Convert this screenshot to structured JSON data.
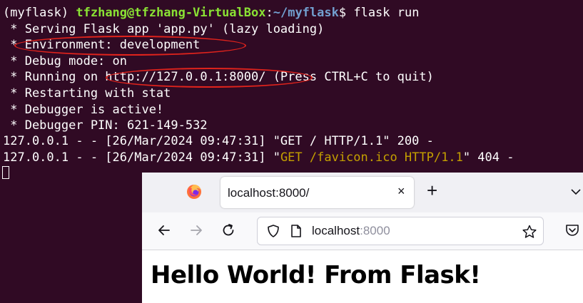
{
  "terminal": {
    "prompt": {
      "env": "(myflask)",
      "userhost": "tfzhang@tfzhang-VirtualBox",
      "colon": ":",
      "path": "~/myflask",
      "dollar": "$",
      "command": " flask run"
    },
    "output": [
      " * Serving Flask app 'app.py' (lazy loading)",
      " * Environment: development",
      " * Debug mode: on",
      " * Running on http://127.0.0.1:8000/ (Press CTRL+C to quit)",
      " * Restarting with stat",
      " * Debugger is active!",
      " * Debugger PIN: 621-149-532",
      "127.0.0.1 - - [26/Mar/2024 09:47:31] \"GET / HTTP/1.1\" 200 -"
    ],
    "last_log": {
      "prefix": "127.0.0.1 - - [26/Mar/2024 09:47:31] \"",
      "request": "GET /favicon.ico HTTP/1.1",
      "suffix": "\" 404 -"
    },
    "colors": {
      "background": "#300a24",
      "prompt_user": "#8ae234",
      "prompt_path": "#729fcf",
      "warning": "#c4a000",
      "annotation": "#e0231c"
    }
  },
  "browser": {
    "tab": {
      "title": "localhost:8000/",
      "close": "×"
    },
    "new_tab": "+",
    "address": {
      "host": "localhost",
      "port": ":8000"
    },
    "page": {
      "heading": "Hello World! From Flask!"
    }
  }
}
